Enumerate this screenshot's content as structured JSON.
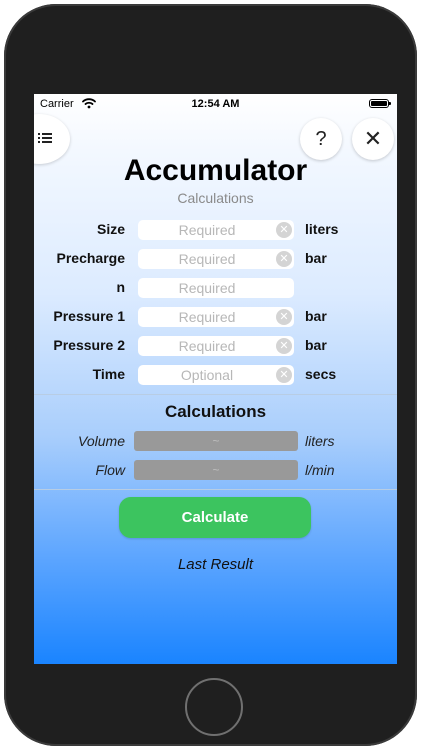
{
  "status_bar": {
    "carrier": "Carrier",
    "time": "12:54 AM"
  },
  "header": {
    "menu_icon": "list-icon",
    "help_label": "?",
    "close_label": "✕",
    "title": "Accumulator",
    "subtitle": "Calculations"
  },
  "inputs": [
    {
      "label": "Size",
      "placeholder": "Required",
      "unit": "liters"
    },
    {
      "label": "Precharge",
      "placeholder": "Required",
      "unit": "bar"
    },
    {
      "label": "n",
      "placeholder": "Required",
      "unit": ""
    },
    {
      "label": "Pressure 1",
      "placeholder": "Required",
      "unit": "bar"
    },
    {
      "label": "Pressure 2",
      "placeholder": "Required",
      "unit": "bar"
    },
    {
      "label": "Time",
      "placeholder": "Optional",
      "unit": "secs"
    }
  ],
  "calculations": {
    "title": "Calculations",
    "rows": [
      {
        "label": "Volume",
        "value": "~",
        "unit": "liters"
      },
      {
        "label": "Flow",
        "value": "~",
        "unit": "l/min"
      }
    ]
  },
  "actions": {
    "calculate_label": "Calculate",
    "last_result_label": "Last Result"
  },
  "colors": {
    "accent_green": "#3CC45F",
    "gradient_bottom": "#1A84FF",
    "output_box": "#999999"
  }
}
